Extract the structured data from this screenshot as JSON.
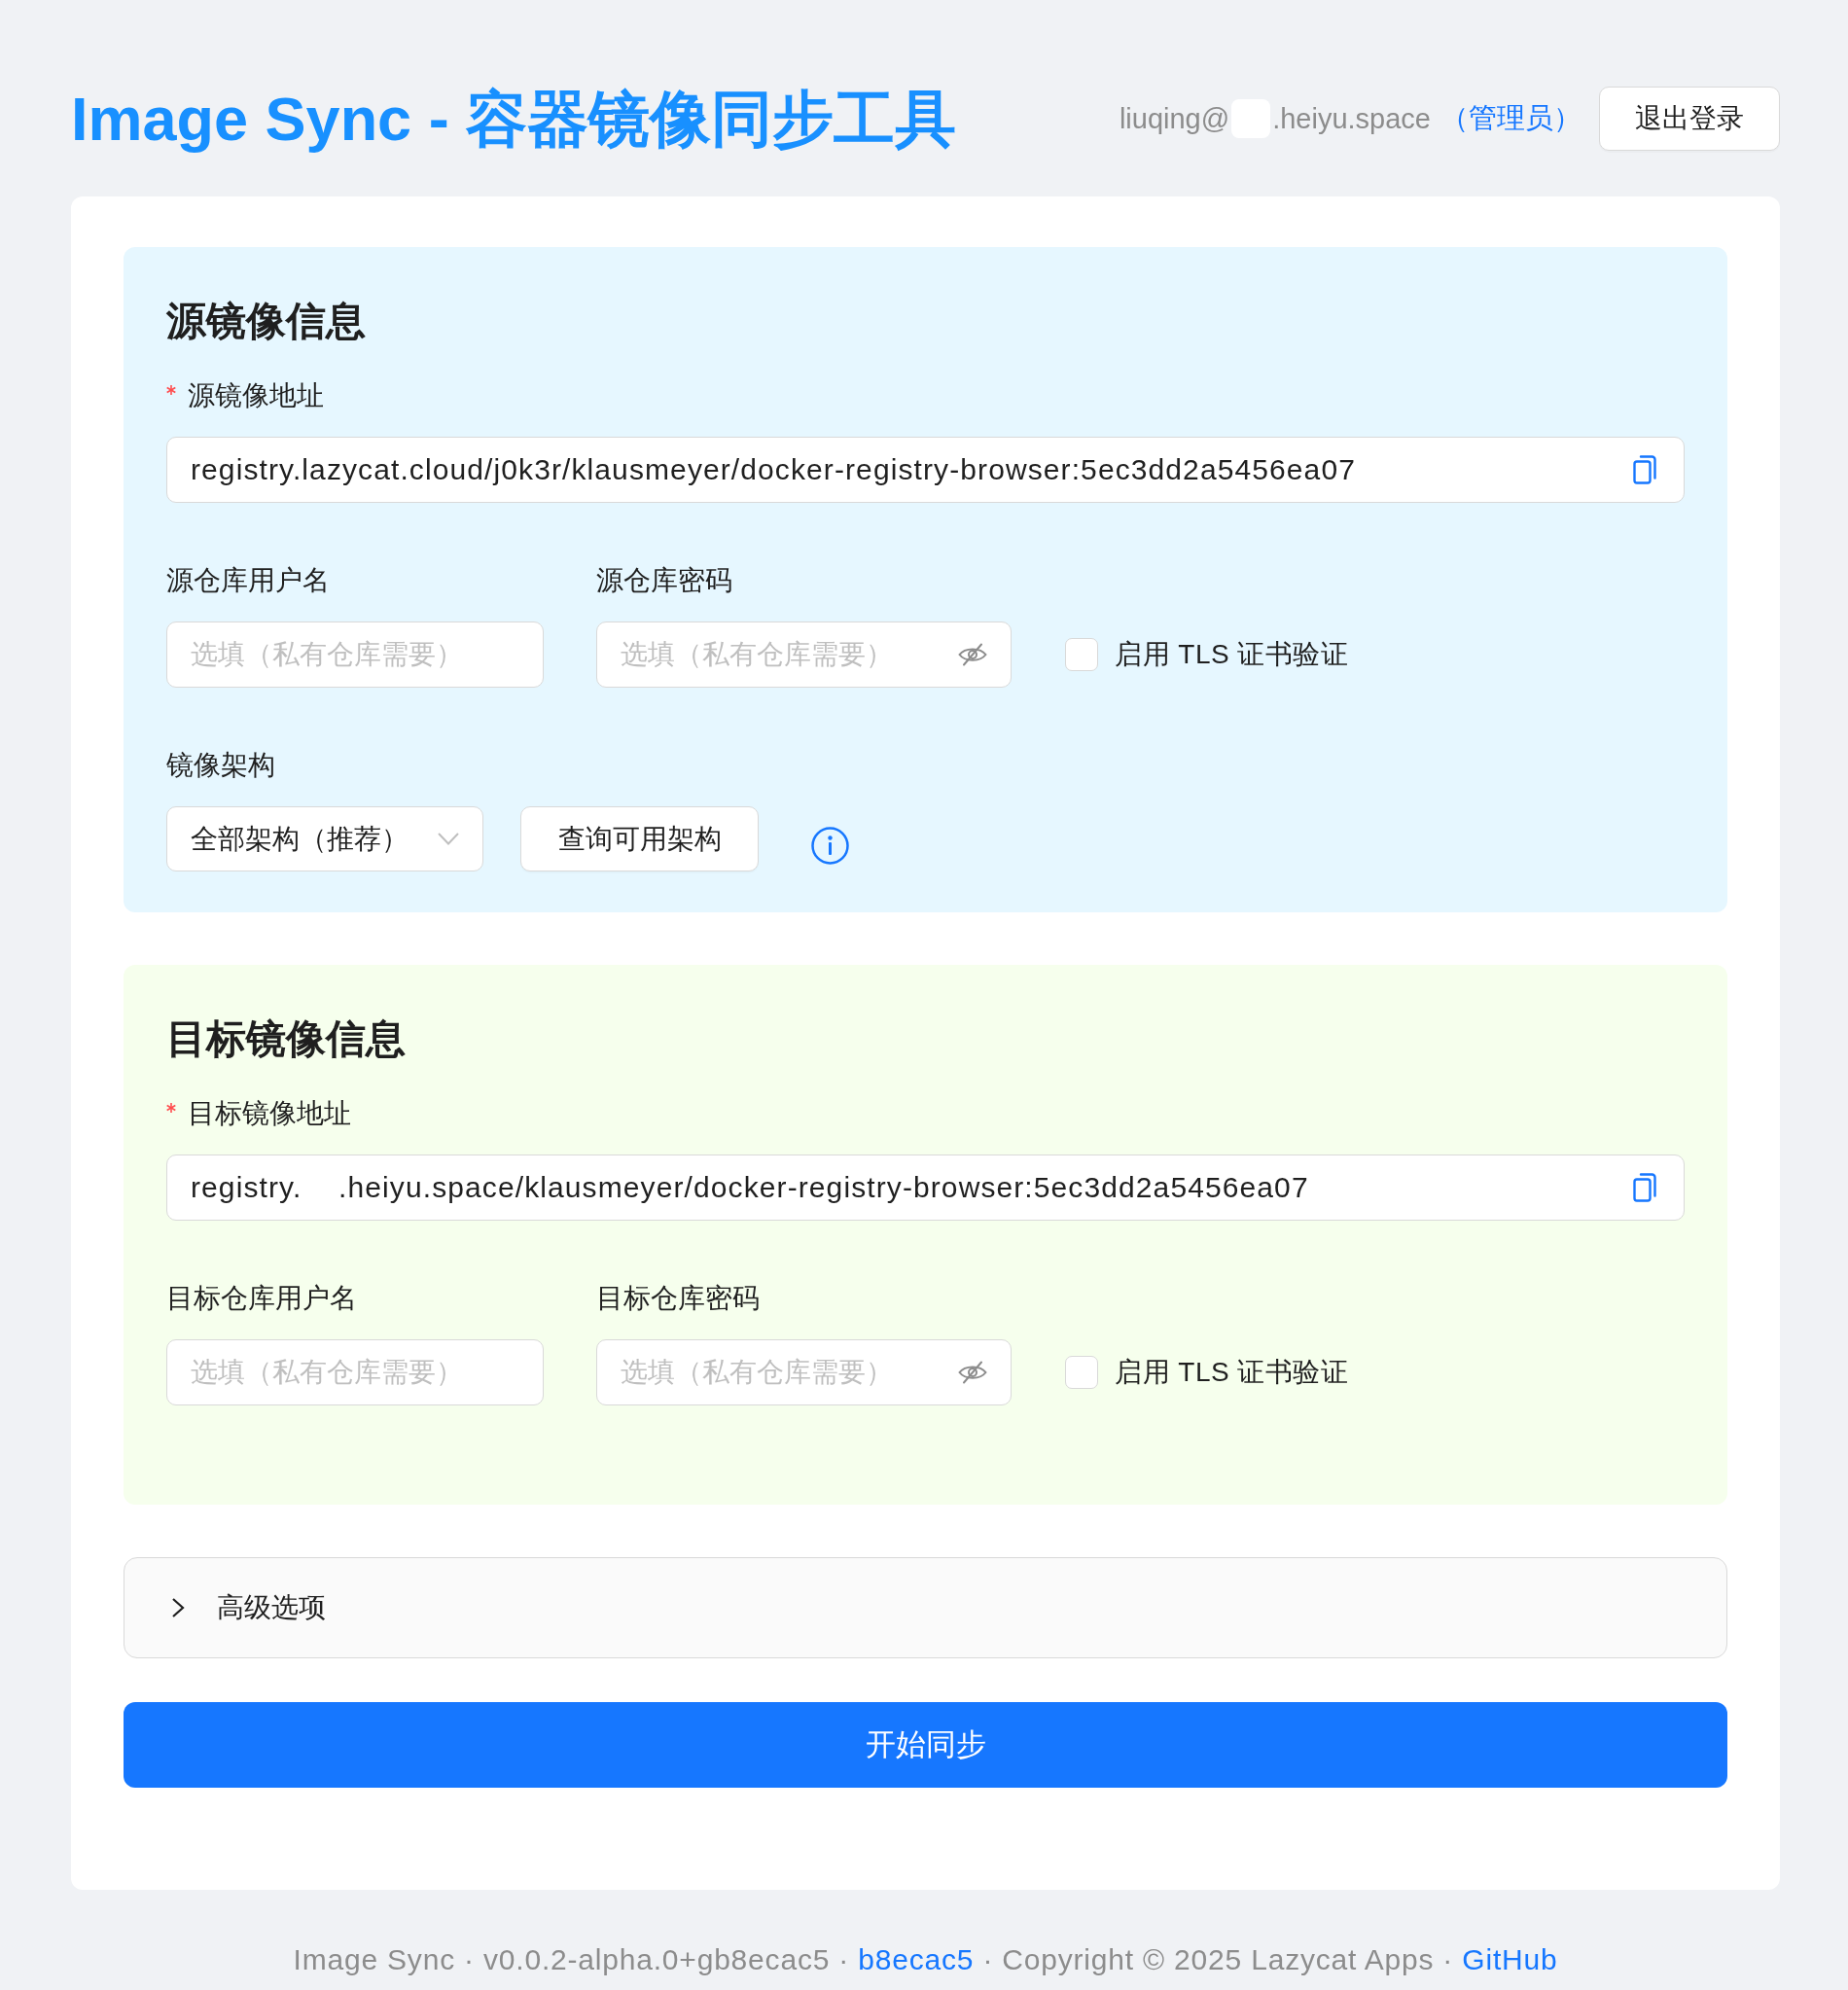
{
  "header": {
    "title": "Image Sync - 容器镜像同步工具",
    "user": {
      "email_parts": [
        "liuqing@",
        ".heiyu.space"
      ],
      "role": "（管理员）"
    },
    "logout_button": "退出登录"
  },
  "sections": [
    {
      "kind": "source",
      "title": "源镜像信息",
      "address": {
        "label": "源镜像地址",
        "required": true,
        "value": "registry.lazycat.cloud/j0k3r/klausmeyer/docker-registry-browser:5ec3dd2a5456ea07"
      },
      "username": {
        "label": "源仓库用户名",
        "placeholder": "选填（私有仓库需要）"
      },
      "password": {
        "label": "源仓库密码",
        "placeholder": "选填（私有仓库需要）"
      },
      "tls": {
        "label": "启用 TLS 证书验证",
        "checked": false
      },
      "architecture": {
        "label": "镜像架构",
        "value": "全部架构（推荐）",
        "query_button": "查询可用架构"
      }
    },
    {
      "kind": "target",
      "title": "目标镜像信息",
      "address": {
        "label": "目标镜像地址",
        "required": true,
        "value": "registry.    .heiyu.space/klausmeyer/docker-registry-browser:5ec3dd2a5456ea07"
      },
      "username": {
        "label": "目标仓库用户名",
        "placeholder": "选填（私有仓库需要）"
      },
      "password": {
        "label": "目标仓库密码",
        "placeholder": "选填（私有仓库需要）"
      },
      "tls": {
        "label": "启用 TLS 证书验证",
        "checked": false
      }
    }
  ],
  "advanced": {
    "label": "高级选项",
    "expanded": false
  },
  "submit_button": "开始同步",
  "footer": [
    {
      "kind": "text",
      "text": "Image Sync · v0.0.2-alpha.0+gb8ecac5 · "
    },
    {
      "kind": "link",
      "text": "b8ecac5"
    },
    {
      "kind": "text",
      "text": " · Copyright © 2025 Lazycat Apps · "
    },
    {
      "kind": "link",
      "text": "GitHub"
    }
  ]
}
